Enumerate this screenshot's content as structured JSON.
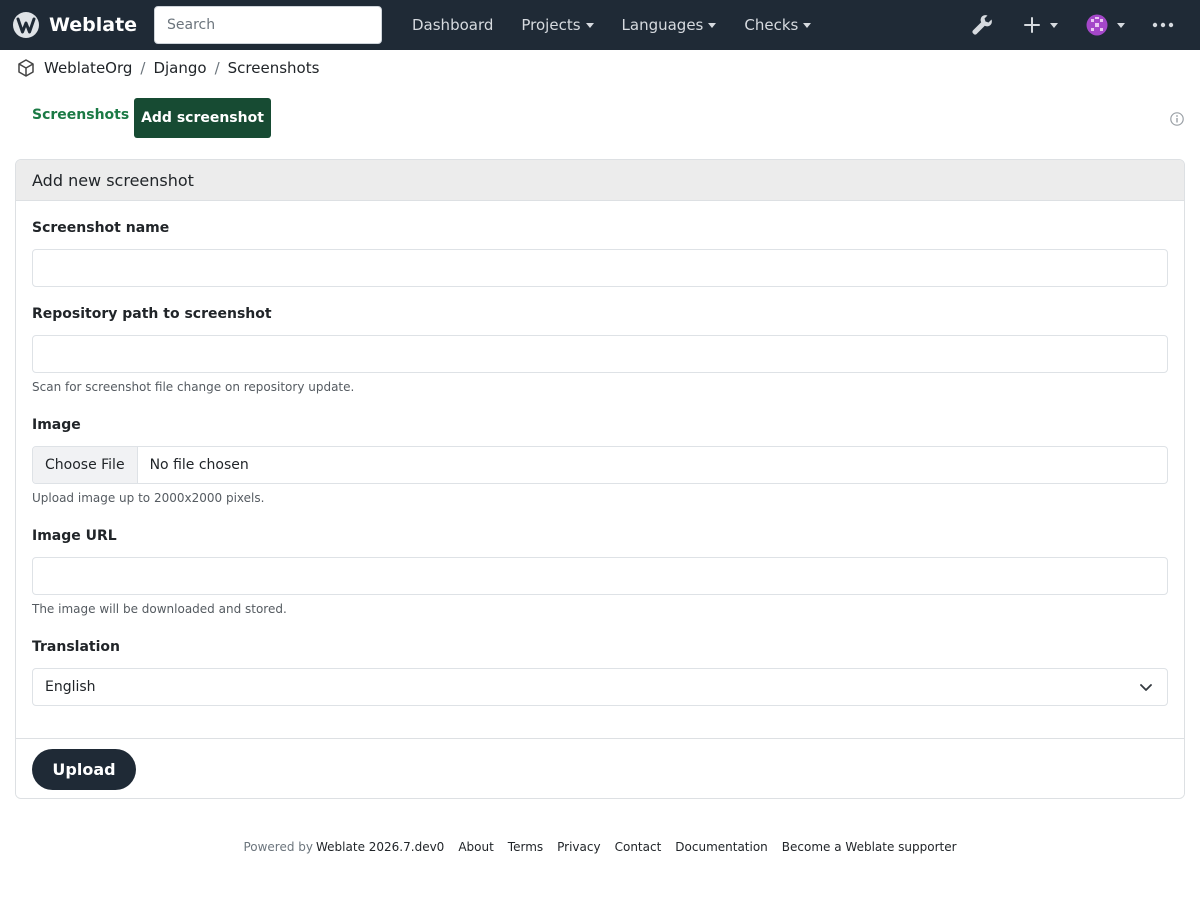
{
  "app": {
    "name": "Weblate"
  },
  "search": {
    "placeholder": "Search"
  },
  "nav": {
    "items": [
      {
        "label": "Dashboard",
        "dropdown": false
      },
      {
        "label": "Projects",
        "dropdown": true
      },
      {
        "label": "Languages",
        "dropdown": true
      },
      {
        "label": "Checks",
        "dropdown": true
      }
    ],
    "icons": [
      "wrench-icon",
      "plus-icon",
      "avatar",
      "more-icon"
    ]
  },
  "breadcrumb": {
    "items": [
      "WeblateOrg",
      "Django",
      "Screenshots"
    ]
  },
  "tabs": {
    "screenshots": "Screenshots",
    "add": "Add screenshot"
  },
  "form": {
    "title": "Add new screenshot",
    "name_label": "Screenshot name",
    "name_value": "",
    "repo_label": "Repository path to screenshot",
    "repo_value": "",
    "repo_help": "Scan for screenshot file change on repository update.",
    "image_label": "Image",
    "image_button": "Choose File",
    "image_status": "No file chosen",
    "image_help": "Upload image up to 2000x2000 pixels.",
    "url_label": "Image URL",
    "url_value": "",
    "url_help": "The image will be downloaded and stored.",
    "translation_label": "Translation",
    "translation_value": "English",
    "submit": "Upload"
  },
  "footer": {
    "powered_by": "Powered by",
    "version": "Weblate 2026.7.dev0",
    "links": [
      "About",
      "Terms",
      "Privacy",
      "Contact",
      "Documentation",
      "Become a Weblate supporter"
    ]
  },
  "colors": {
    "navbar": "#1f2a36",
    "accent": "#174b33",
    "link": "#1b7a45"
  }
}
